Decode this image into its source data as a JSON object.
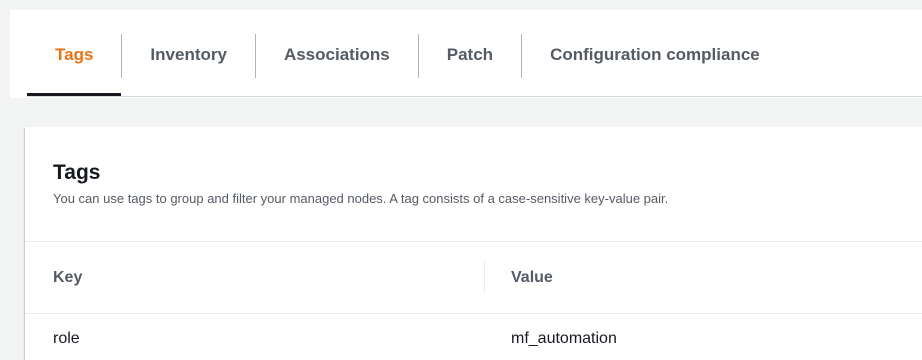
{
  "tabs": [
    {
      "label": "Tags",
      "active": true
    },
    {
      "label": "Inventory",
      "active": false
    },
    {
      "label": "Associations",
      "active": false
    },
    {
      "label": "Patch",
      "active": false
    },
    {
      "label": "Configuration compliance",
      "active": false
    }
  ],
  "panel": {
    "title": "Tags",
    "description": "You can use tags to group and filter your managed nodes. A tag consists of a case-sensitive key-value pair."
  },
  "table": {
    "columns": {
      "key": "Key",
      "value": "Value"
    },
    "rows": [
      {
        "key": "role",
        "value": "mf_automation"
      }
    ]
  },
  "colors": {
    "active_tab": "#ec7211",
    "tab_text": "#545b64",
    "page_background": "#f2f3f3"
  }
}
